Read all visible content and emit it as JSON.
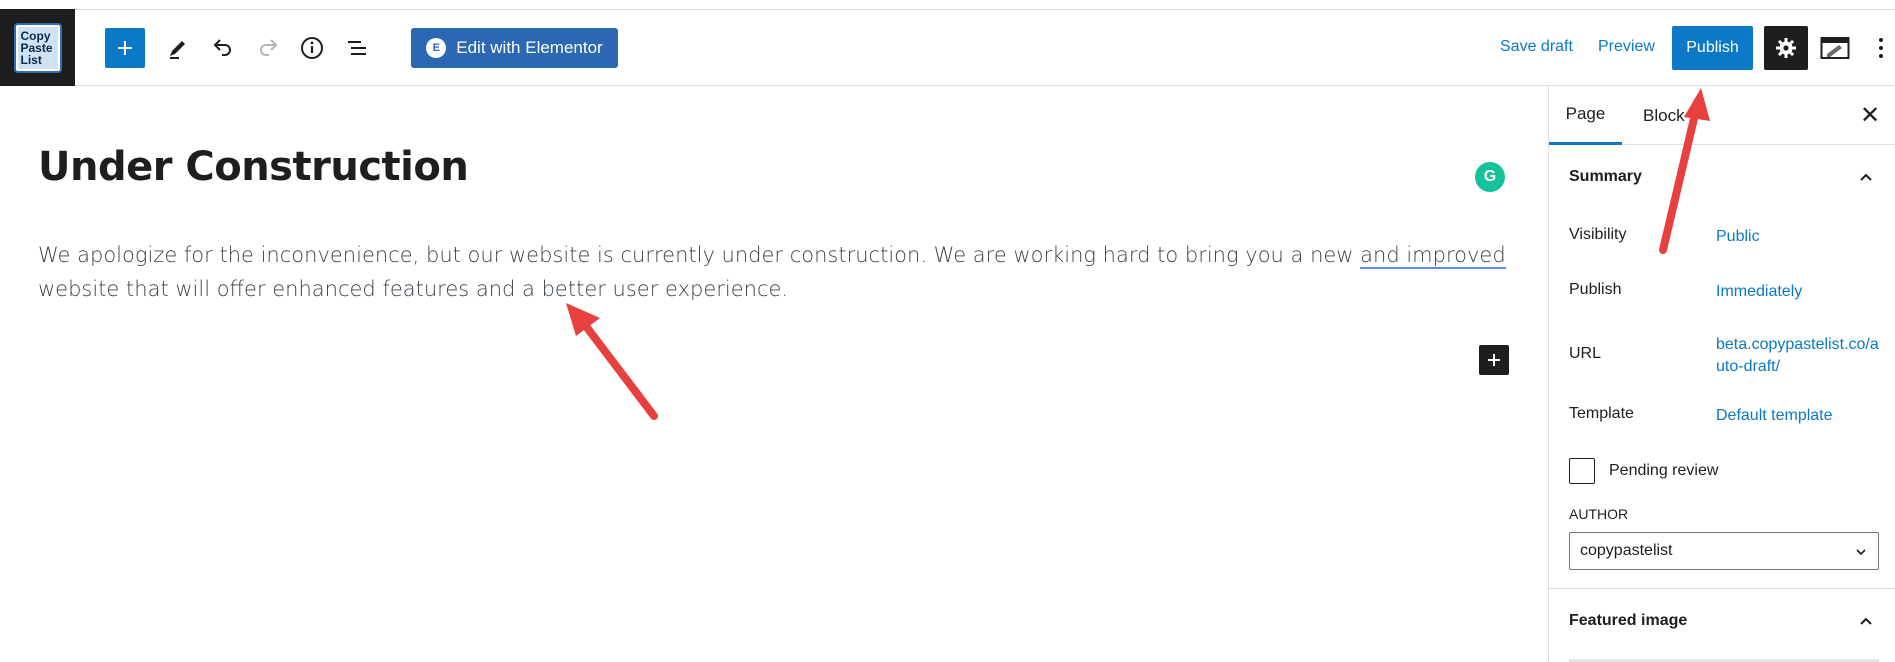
{
  "toolbar": {
    "logo_lines": [
      "Copy",
      "Paste",
      "List"
    ],
    "elementor_badge": "E",
    "elementor_label": "Edit with Elementor",
    "save_draft_label": "Save draft",
    "preview_label": "Preview",
    "publish_label": "Publish",
    "icons": [
      "plus-icon",
      "pencil-icon",
      "undo-icon",
      "redo-icon",
      "info-icon",
      "list-view-icon",
      "settings-gear-icon",
      "elementor-panel-icon",
      "more-vertical-icon"
    ]
  },
  "editor": {
    "title": "Under Construction",
    "paragraph_before": "We apologize for the inconvenience, but our website is currently under construction. We are working hard to bring you a new ",
    "paragraph_underlined": "and improved",
    "paragraph_after": " website that will offer enhanced features and a better user experience.",
    "grammarly_letter": "G"
  },
  "sidebar": {
    "tabs": [
      "Page",
      "Block"
    ],
    "close_symbol": "✕",
    "summary_title": "Summary",
    "visibility_label": "Visibility",
    "visibility_value": "Public",
    "publish_label": "Publish",
    "publish_value": "Immediately",
    "url_label": "URL",
    "url_value": "beta.copypastelist.co/auto-draft/",
    "template_label": "Template",
    "template_value": "Default template",
    "pending_review_label": "Pending review",
    "pending_review_checked": false,
    "author_label": "AUTHOR",
    "author_value": "copypastelist",
    "featured_image_title": "Featured image"
  },
  "colors": {
    "accent": "#0b79c8",
    "elementor": "#2b67b2",
    "dark": "#1e1e1e",
    "annotation_arrow": "#e8403e",
    "grammarly": "#15c39a"
  }
}
